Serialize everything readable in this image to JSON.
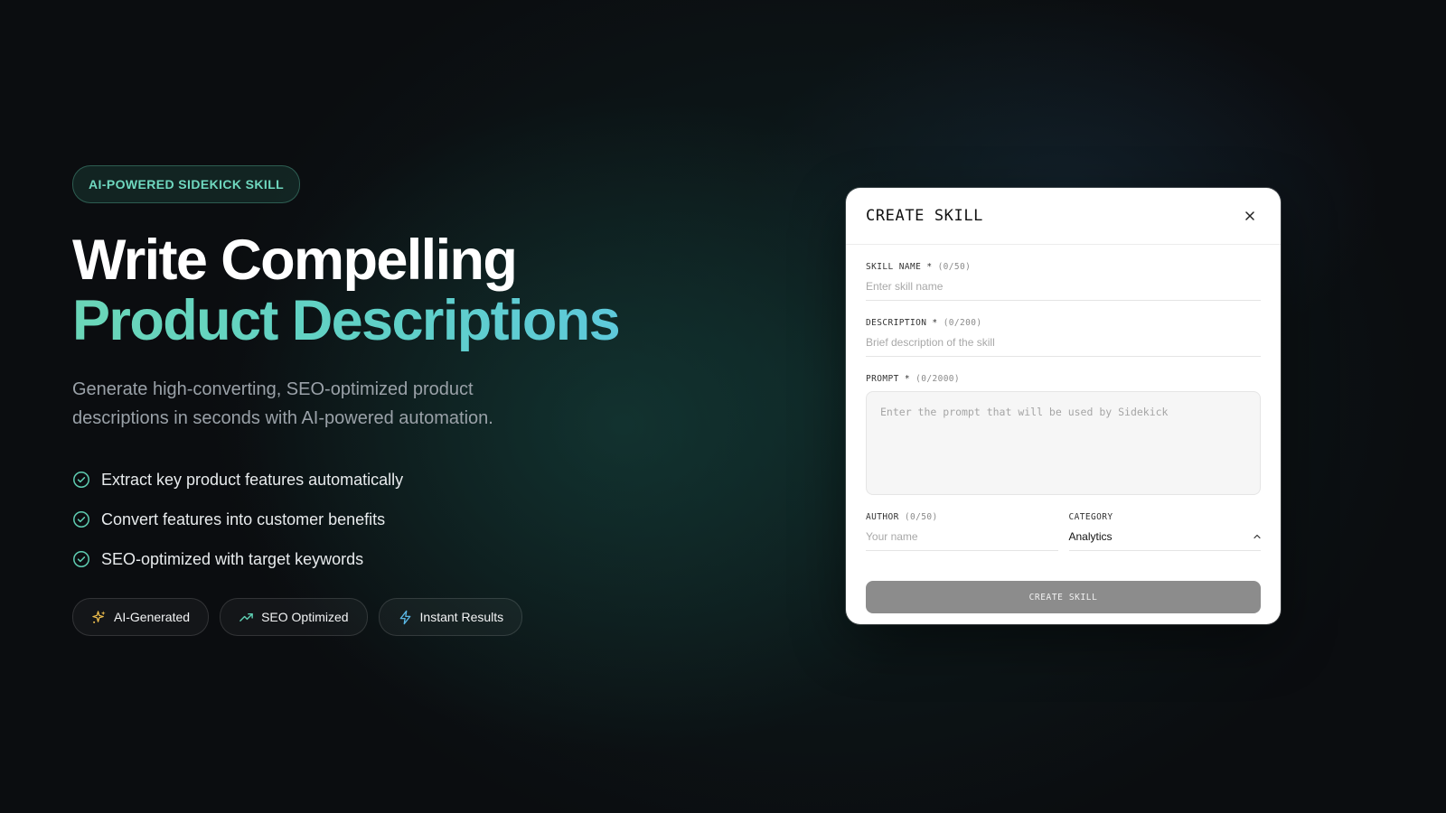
{
  "hero": {
    "badge": "AI-POWERED SIDEKICK SKILL",
    "title_line1": "Write Compelling",
    "title_line2": "Product Descriptions",
    "subtitle": "Generate high-converting, SEO-optimized product descriptions in seconds with AI-powered automation.",
    "features": [
      "Extract key product features automatically",
      "Convert features into customer benefits",
      "SEO-optimized with target keywords"
    ],
    "pills": [
      {
        "label": "AI-Generated",
        "icon": "sparkles-icon"
      },
      {
        "label": "SEO Optimized",
        "icon": "trending-up-icon"
      },
      {
        "label": "Instant Results",
        "icon": "lightning-icon"
      }
    ]
  },
  "modal": {
    "title": "CREATE SKILL",
    "close_icon": "close-icon",
    "skill_name": {
      "label": "SKILL NAME *",
      "count": "(0/50)",
      "placeholder": "Enter skill name",
      "value": ""
    },
    "description": {
      "label": "DESCRIPTION *",
      "count": "(0/200)",
      "placeholder": "Brief description of the skill",
      "value": ""
    },
    "prompt": {
      "label": "PROMPT *",
      "count": "(0/2000)",
      "placeholder": "Enter the prompt that will be used by Sidekick",
      "value": ""
    },
    "author": {
      "label": "AUTHOR",
      "count": "(0/50)",
      "placeholder": "Your name",
      "value": ""
    },
    "category": {
      "label": "CATEGORY",
      "value": "Analytics"
    },
    "submit_label": "CREATE SKILL"
  },
  "colors": {
    "accent_teal": "#6fd8bf",
    "gradient_start": "#6ad6b8",
    "gradient_end": "#5ec6e4",
    "submit_bg": "#8c8c8c",
    "background": "#0b0d10"
  }
}
